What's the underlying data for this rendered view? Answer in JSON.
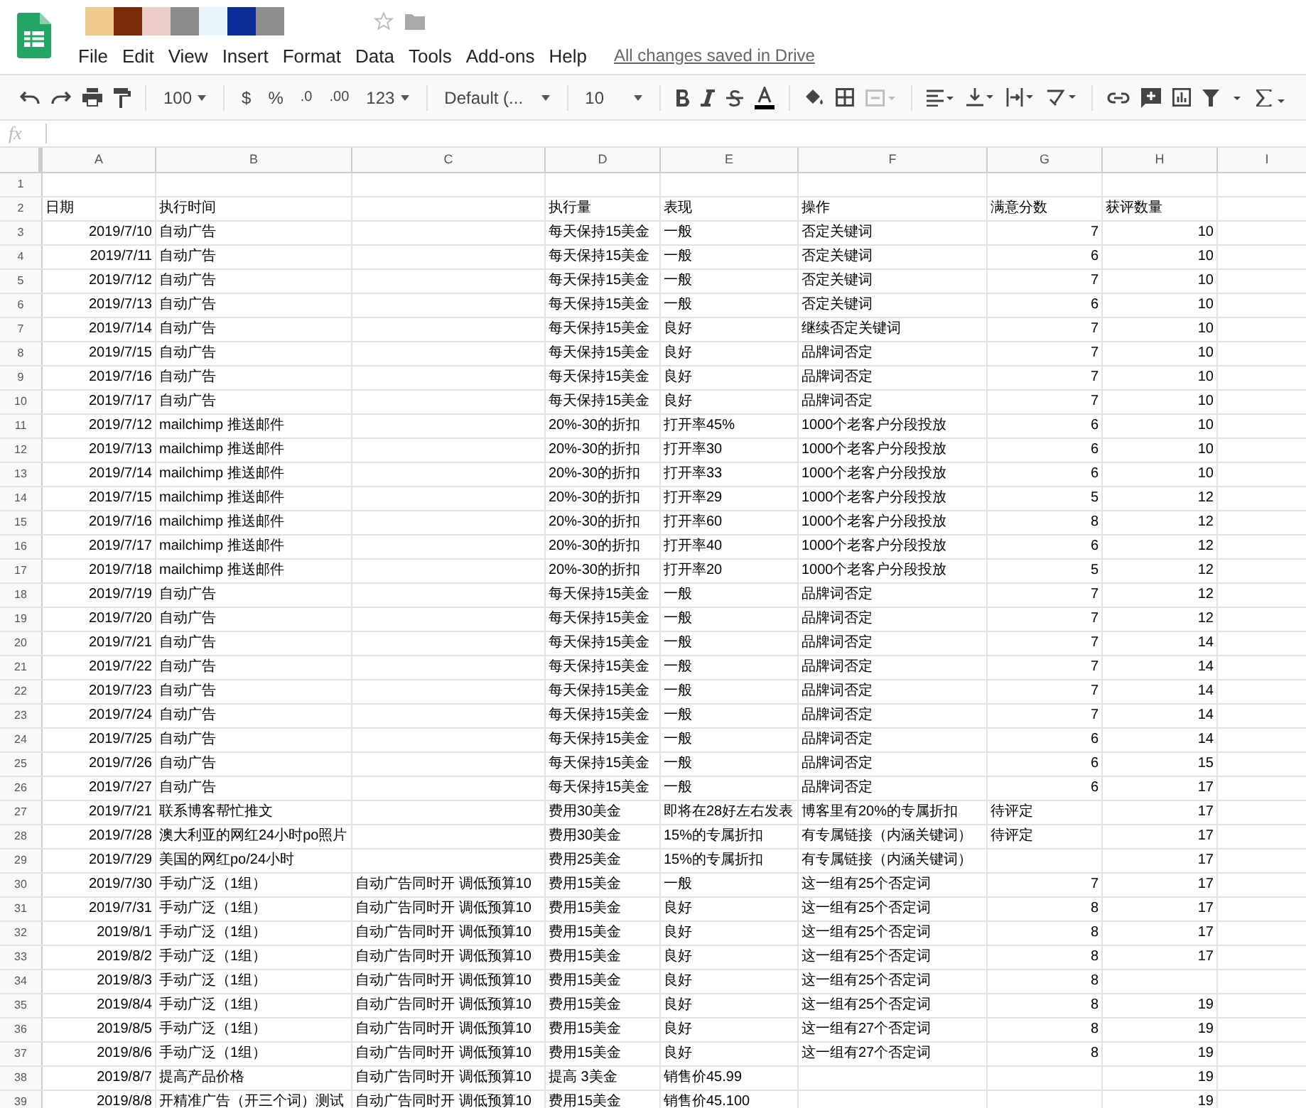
{
  "title_blocks": [
    {
      "color": "#edc98e"
    },
    {
      "color": "#7b2a09"
    },
    {
      "color": "#e8ccc5"
    },
    {
      "color": "#8c8c8c"
    },
    {
      "color": "#e8f4fc"
    },
    {
      "color": "#0a2f99"
    },
    {
      "color": "#8e8e8e"
    }
  ],
  "menu": [
    "File",
    "Edit",
    "View",
    "Insert",
    "Format",
    "Data",
    "Tools",
    "Add-ons",
    "Help"
  ],
  "save_status": "All changes saved in Drive",
  "toolbar": {
    "zoom": "100",
    "currency": "$",
    "percent": "%",
    "decrease_decimals": ".0",
    "increase_decimals": ".00",
    "more_formats": "123",
    "font": "Default (...",
    "font_size": "10"
  },
  "formula_bar": {
    "label": "fx"
  },
  "columns": [
    "A",
    "B",
    "C",
    "D",
    "E",
    "F",
    "G",
    "H",
    "I"
  ],
  "rows": [
    {
      "number": "1",
      "text_cells": {},
      "number_cells": {}
    },
    {
      "number": "2",
      "text_cells": {
        "A": "日期",
        "B": "执行时间",
        "D": "执行量",
        "E": "表现",
        "F": "操作",
        "G": "满意分数",
        "H": "获评数量"
      },
      "number_cells": {}
    },
    {
      "number": "3",
      "number_cells": {
        "A": "2019/7/10",
        "G": "7",
        "H": "10"
      },
      "text_cells": {
        "B": "自动广告",
        "D": "每天保持15美金",
        "E": "一般",
        "F": "否定关键词"
      }
    },
    {
      "number": "4",
      "number_cells": {
        "A": "2019/7/11",
        "G": "6",
        "H": "10"
      },
      "text_cells": {
        "B": "自动广告",
        "D": "每天保持15美金",
        "E": "一般",
        "F": "否定关键词"
      }
    },
    {
      "number": "5",
      "number_cells": {
        "A": "2019/7/12",
        "G": "7",
        "H": "10"
      },
      "text_cells": {
        "B": "自动广告",
        "D": "每天保持15美金",
        "E": "一般",
        "F": "否定关键词"
      }
    },
    {
      "number": "6",
      "number_cells": {
        "A": "2019/7/13",
        "G": "6",
        "H": "10"
      },
      "text_cells": {
        "B": "自动广告",
        "D": "每天保持15美金",
        "E": "一般",
        "F": "否定关键词"
      }
    },
    {
      "number": "7",
      "number_cells": {
        "A": "2019/7/14",
        "G": "7",
        "H": "10"
      },
      "text_cells": {
        "B": "自动广告",
        "D": "每天保持15美金",
        "E": "良好",
        "F": "继续否定关键词"
      }
    },
    {
      "number": "8",
      "number_cells": {
        "A": "2019/7/15",
        "G": "7",
        "H": "10"
      },
      "text_cells": {
        "B": "自动广告",
        "D": "每天保持15美金",
        "E": "良好",
        "F": "品牌词否定"
      }
    },
    {
      "number": "9",
      "number_cells": {
        "A": "2019/7/16",
        "G": "7",
        "H": "10"
      },
      "text_cells": {
        "B": "自动广告",
        "D": "每天保持15美金",
        "E": "良好",
        "F": "品牌词否定"
      }
    },
    {
      "number": "10",
      "number_cells": {
        "A": "2019/7/17",
        "G": "7",
        "H": "10"
      },
      "text_cells": {
        "B": "自动广告",
        "D": "每天保持15美金",
        "E": "良好",
        "F": "品牌词否定"
      }
    },
    {
      "number": "11",
      "number_cells": {
        "A": "2019/7/12",
        "G": "6",
        "H": "10"
      },
      "text_cells": {
        "B": "mailchimp 推送邮件",
        "D": "20%-30的折扣",
        "E": "打开率45%",
        "F": "1000个老客户分段投放"
      }
    },
    {
      "number": "12",
      "number_cells": {
        "A": "2019/7/13",
        "G": "6",
        "H": "10"
      },
      "text_cells": {
        "B": "mailchimp 推送邮件",
        "D": "20%-30的折扣",
        "E": "打开率30",
        "F": "1000个老客户分段投放"
      }
    },
    {
      "number": "13",
      "number_cells": {
        "A": "2019/7/14",
        "G": "6",
        "H": "10"
      },
      "text_cells": {
        "B": "mailchimp 推送邮件",
        "D": "20%-30的折扣",
        "E": "打开率33",
        "F": "1000个老客户分段投放"
      }
    },
    {
      "number": "14",
      "number_cells": {
        "A": "2019/7/15",
        "G": "5",
        "H": "12"
      },
      "text_cells": {
        "B": "mailchimp 推送邮件",
        "D": "20%-30的折扣",
        "E": "打开率29",
        "F": "1000个老客户分段投放"
      }
    },
    {
      "number": "15",
      "number_cells": {
        "A": "2019/7/16",
        "G": "8",
        "H": "12"
      },
      "text_cells": {
        "B": "mailchimp 推送邮件",
        "D": "20%-30的折扣",
        "E": "打开率60",
        "F": "1000个老客户分段投放"
      }
    },
    {
      "number": "16",
      "number_cells": {
        "A": "2019/7/17",
        "G": "6",
        "H": "12"
      },
      "text_cells": {
        "B": "mailchimp 推送邮件",
        "D": "20%-30的折扣",
        "E": "打开率40",
        "F": "1000个老客户分段投放"
      }
    },
    {
      "number": "17",
      "number_cells": {
        "A": "2019/7/18",
        "G": "5",
        "H": "12"
      },
      "text_cells": {
        "B": "mailchimp 推送邮件",
        "D": "20%-30的折扣",
        "E": "打开率20",
        "F": "1000个老客户分段投放"
      }
    },
    {
      "number": "18",
      "number_cells": {
        "A": "2019/7/19",
        "G": "7",
        "H": "12"
      },
      "text_cells": {
        "B": "自动广告",
        "D": "每天保持15美金",
        "E": "一般",
        "F": "品牌词否定"
      }
    },
    {
      "number": "19",
      "number_cells": {
        "A": "2019/7/20",
        "G": "7",
        "H": "12"
      },
      "text_cells": {
        "B": "自动广告",
        "D": "每天保持15美金",
        "E": "一般",
        "F": "品牌词否定"
      }
    },
    {
      "number": "20",
      "number_cells": {
        "A": "2019/7/21",
        "G": "7",
        "H": "14"
      },
      "text_cells": {
        "B": "自动广告",
        "D": "每天保持15美金",
        "E": "一般",
        "F": "品牌词否定"
      }
    },
    {
      "number": "21",
      "number_cells": {
        "A": "2019/7/22",
        "G": "7",
        "H": "14"
      },
      "text_cells": {
        "B": "自动广告",
        "D": "每天保持15美金",
        "E": "一般",
        "F": "品牌词否定"
      }
    },
    {
      "number": "22",
      "number_cells": {
        "A": "2019/7/23",
        "G": "7",
        "H": "14"
      },
      "text_cells": {
        "B": "自动广告",
        "D": "每天保持15美金",
        "E": "一般",
        "F": "品牌词否定"
      }
    },
    {
      "number": "23",
      "number_cells": {
        "A": "2019/7/24",
        "G": "7",
        "H": "14"
      },
      "text_cells": {
        "B": "自动广告",
        "D": "每天保持15美金",
        "E": "一般",
        "F": "品牌词否定"
      }
    },
    {
      "number": "24",
      "number_cells": {
        "A": "2019/7/25",
        "G": "6",
        "H": "14"
      },
      "text_cells": {
        "B": "自动广告",
        "D": "每天保持15美金",
        "E": "一般",
        "F": "品牌词否定"
      }
    },
    {
      "number": "25",
      "number_cells": {
        "A": "2019/7/26",
        "G": "6",
        "H": "15"
      },
      "text_cells": {
        "B": "自动广告",
        "D": "每天保持15美金",
        "E": "一般",
        "F": "品牌词否定"
      }
    },
    {
      "number": "26",
      "number_cells": {
        "A": "2019/7/27",
        "G": "6",
        "H": "17"
      },
      "text_cells": {
        "B": "自动广告",
        "D": "每天保持15美金",
        "E": "一般",
        "F": "品牌词否定"
      }
    },
    {
      "number": "27",
      "number_cells": {
        "A": "2019/7/21",
        "H": "17"
      },
      "text_cells": {
        "B": "联系博客帮忙推文",
        "D": "费用30美金",
        "E": "即将在28好左右发表",
        "F": "博客里有20%的专属折扣",
        "G": "待评定"
      }
    },
    {
      "number": "28",
      "number_cells": {
        "A": "2019/7/28",
        "H": "17"
      },
      "text_cells": {
        "B": "澳大利亚的网红24小时po照片",
        "D": "费用30美金",
        "E": "15%的专属折扣",
        "F": "有专属链接（内涵关键词）",
        "G": "待评定"
      }
    },
    {
      "number": "29",
      "number_cells": {
        "A": "2019/7/29",
        "H": "17"
      },
      "text_cells": {
        "B": "美国的网红po/24小时",
        "D": "费用25美金",
        "E": "15%的专属折扣",
        "F": "有专属链接（内涵关键词）"
      }
    },
    {
      "number": "30",
      "number_cells": {
        "A": "2019/7/30",
        "G": "7",
        "H": "17"
      },
      "text_cells": {
        "B": "手动广泛（1组）",
        "C": "自动广告同时开 调低预算10",
        "D": "费用15美金",
        "E": "一般",
        "F": "这一组有25个否定词"
      }
    },
    {
      "number": "31",
      "number_cells": {
        "A": "2019/7/31",
        "G": "8",
        "H": "17"
      },
      "text_cells": {
        "B": "手动广泛（1组）",
        "C": "自动广告同时开 调低预算10",
        "D": "费用15美金",
        "E": "良好",
        "F": "这一组有25个否定词"
      }
    },
    {
      "number": "32",
      "number_cells": {
        "A": "2019/8/1",
        "G": "8",
        "H": "17"
      },
      "text_cells": {
        "B": "手动广泛（1组）",
        "C": "自动广告同时开 调低预算10",
        "D": "费用15美金",
        "E": "良好",
        "F": "这一组有25个否定词"
      }
    },
    {
      "number": "33",
      "number_cells": {
        "A": "2019/8/2",
        "G": "8",
        "H": "17"
      },
      "text_cells": {
        "B": "手动广泛（1组）",
        "C": "自动广告同时开 调低预算10",
        "D": "费用15美金",
        "E": "良好",
        "F": "这一组有25个否定词"
      }
    },
    {
      "number": "34",
      "number_cells": {
        "A": "2019/8/3",
        "G": "8"
      },
      "text_cells": {
        "B": "手动广泛（1组）",
        "C": "自动广告同时开 调低预算10",
        "D": "费用15美金",
        "E": "良好",
        "F": "这一组有25个否定词"
      }
    },
    {
      "number": "35",
      "number_cells": {
        "A": "2019/8/4",
        "G": "8",
        "H": "19"
      },
      "text_cells": {
        "B": "手动广泛（1组）",
        "C": "自动广告同时开 调低预算10",
        "D": "费用15美金",
        "E": "良好",
        "F": "这一组有25个否定词"
      }
    },
    {
      "number": "36",
      "number_cells": {
        "A": "2019/8/5",
        "G": "8",
        "H": "19"
      },
      "text_cells": {
        "B": "手动广泛（1组）",
        "C": "自动广告同时开 调低预算10",
        "D": "费用15美金",
        "E": "良好",
        "F": "这一组有27个否定词"
      }
    },
    {
      "number": "37",
      "number_cells": {
        "A": "2019/8/6",
        "G": "8",
        "H": "19"
      },
      "text_cells": {
        "B": "手动广泛（1组）",
        "C": "自动广告同时开 调低预算10",
        "D": "费用15美金",
        "E": "良好",
        "F": "这一组有27个否定词"
      }
    },
    {
      "number": "38",
      "number_cells": {
        "A": "2019/8/7",
        "H": "19"
      },
      "text_cells": {
        "B": "提高产品价格",
        "C": "自动广告同时开 调低预算10",
        "D": "提高 3美金",
        "E": "销售价45.99"
      }
    },
    {
      "number": "39",
      "number_cells": {
        "A": "2019/8/8",
        "H": "19"
      },
      "text_cells": {
        "B": "开精准广告（开三个词）测试",
        "C": "自动广告同时开 调低预算10",
        "D": "费用15美金",
        "E": "销售价45.100"
      }
    }
  ]
}
